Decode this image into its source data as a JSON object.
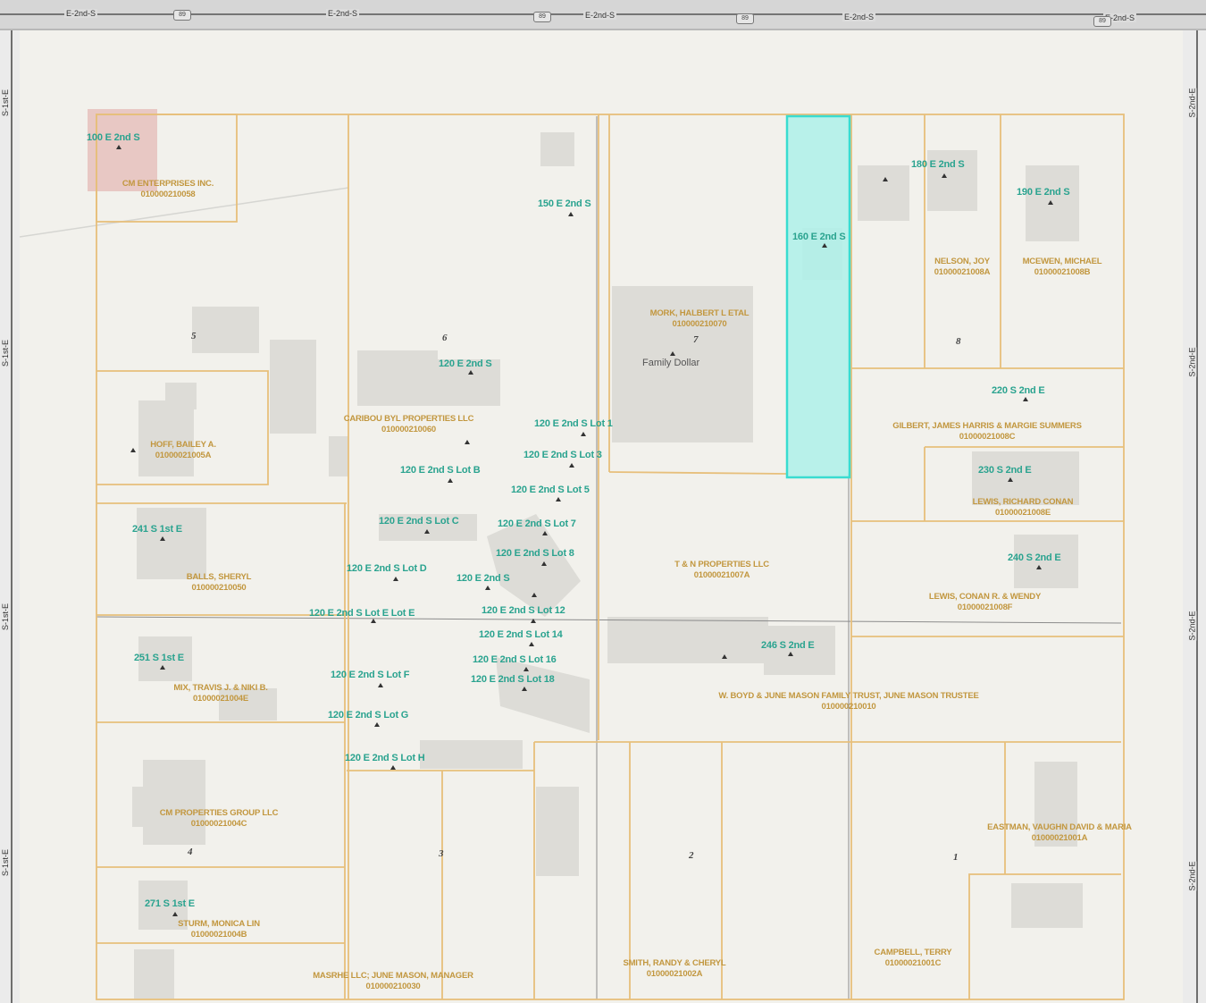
{
  "streets": {
    "north": "E-2nd-S",
    "west": "S-1st-E",
    "east": "S-2nd-E",
    "shield": "89"
  },
  "blocks": [
    "1",
    "2",
    "3",
    "4",
    "5",
    "6",
    "7",
    "8"
  ],
  "store_label": "Family Dollar",
  "colors": {
    "parcel_line": "#e7bf7b",
    "selected_parcel": "#39dcd0",
    "address_text": "#2aa38f",
    "owner_text": "#c2973f",
    "building": "#dddcd7",
    "highlight_building": "#e8c8c4"
  },
  "addresses": [
    "100 E 2nd S",
    "150 E 2nd S",
    "160 E 2nd S",
    "180 E 2nd S",
    "190 E 2nd S",
    "120 E 2nd S",
    "120 E 2nd S Lot 1",
    "120 E 2nd S Lot 3",
    "120 E 2nd S Lot B",
    "120 E 2nd S Lot 5",
    "120 E 2nd S Lot C",
    "120 E 2nd S Lot 7",
    "120 E 2nd S Lot 8",
    "120 E 2nd S Lot D",
    "120 E 2nd S",
    "120 E 2nd S Lot E Lot E",
    "120 E 2nd S Lot 12",
    "120 E 2nd S Lot 14",
    "120 E 2nd S Lot 16",
    "120 E 2nd S Lot F",
    "120 E 2nd S Lot 18",
    "120 E 2nd S Lot G",
    "120 E 2nd S Lot H",
    "220 S 2nd E",
    "230 S 2nd E",
    "240 S 2nd E",
    "246 S 2nd E",
    "241 S 1st E",
    "251 S 1st E",
    "271 S 1st E"
  ],
  "owners": [
    {
      "name": "CM ENTERPRISES INC.",
      "parcel": "010000210058"
    },
    {
      "name": "MORK, HALBERT L ETAL",
      "parcel": "010000210070"
    },
    {
      "name": "NELSON, JOY",
      "parcel": "01000021008A"
    },
    {
      "name": "MCEWEN, MICHAEL",
      "parcel": "01000021008B"
    },
    {
      "name": "CARIBOU BYL PROPERTIES LLC",
      "parcel": "010000210060"
    },
    {
      "name": "HOFF, BAILEY A.",
      "parcel": "01000021005A"
    },
    {
      "name": "GILBERT, JAMES HARRIS & MARGIE SUMMERS",
      "parcel": "01000021008C"
    },
    {
      "name": "LEWIS, RICHARD CONAN",
      "parcel": "01000021008E"
    },
    {
      "name": "BALLS, SHERYL",
      "parcel": "010000210050"
    },
    {
      "name": "T & N PROPERTIES LLC",
      "parcel": "01000021007A"
    },
    {
      "name": "LEWIS, CONAN R. & WENDY",
      "parcel": "01000021008F"
    },
    {
      "name": "MIX, TRAVIS J. & NIKI B.",
      "parcel": "01000021004E"
    },
    {
      "name": "W. BOYD & JUNE MASON FAMILY TRUST, JUNE MASON TRUSTEE",
      "parcel": "010000210010"
    },
    {
      "name": "CM PROPERTIES GROUP LLC",
      "parcel": "01000021004C"
    },
    {
      "name": "EASTMAN, VAUGHN DAVID & MARIA",
      "parcel": "01000021001A"
    },
    {
      "name": "STURM, MONICA LIN",
      "parcel": "01000021004B"
    },
    {
      "name": "MASRHE LLC; JUNE MASON, MANAGER",
      "parcel": "010000210030"
    },
    {
      "name": "SMITH, RANDY & CHERYL",
      "parcel": "01000021002A"
    },
    {
      "name": "CAMPBELL, TERRY",
      "parcel": "01000021001C"
    }
  ]
}
